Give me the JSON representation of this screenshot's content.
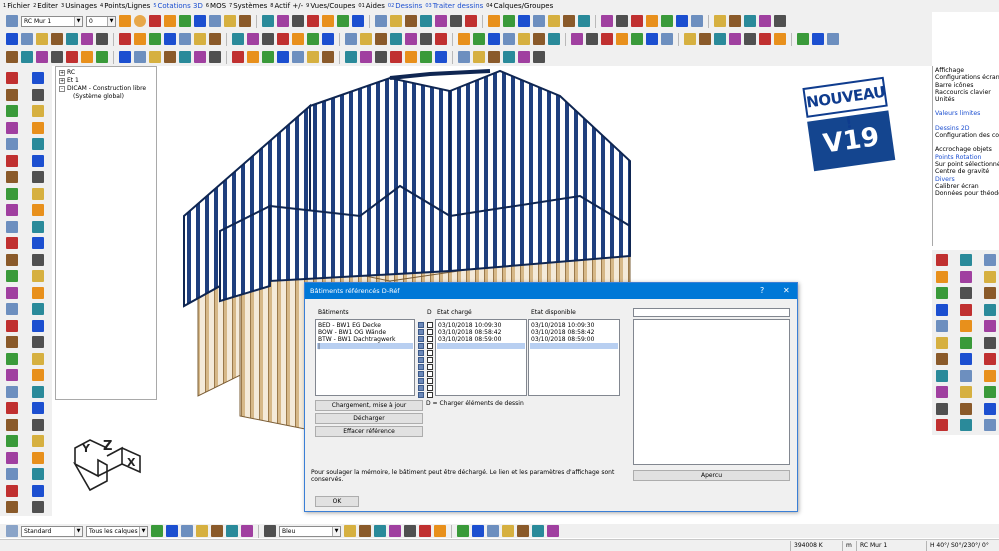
{
  "menu": [
    {
      "num": "1",
      "label": "Fichier"
    },
    {
      "num": "2",
      "label": "Editer"
    },
    {
      "num": "3",
      "label": "Usinages"
    },
    {
      "num": "4",
      "label": "Points/Lignes"
    },
    {
      "num": "5",
      "label": "Cotations 3D",
      "accent": true
    },
    {
      "num": "6",
      "label": "MOS"
    },
    {
      "num": "7",
      "label": "Systèmes"
    },
    {
      "num": "8",
      "label": "Actif +/-"
    },
    {
      "num": "9",
      "label": "Vues/Coupes"
    },
    {
      "num": "01",
      "label": "Aides"
    },
    {
      "num": "02",
      "label": "Dessins",
      "accent": true
    },
    {
      "num": "03",
      "label": "Traiter dessins",
      "accent": true
    },
    {
      "num": "04",
      "label": "Calques/Groupes"
    }
  ],
  "toolbar": {
    "layer_combo": "RC Mur 1",
    "number_combo": "0"
  },
  "tree": [
    {
      "text": "RC",
      "expander": "+",
      "level": 0
    },
    {
      "text": "Et 1",
      "expander": "+",
      "level": 0
    },
    {
      "text": "DICAM - Construction libre",
      "expander": "-",
      "level": 0
    },
    {
      "text": "(Système global)",
      "expander": "",
      "level": 1
    }
  ],
  "axes": {
    "x": "X",
    "y": "Y",
    "z": "Z"
  },
  "right_panel": [
    {
      "text": "Affichage"
    },
    {
      "text": "Configurations écran"
    },
    {
      "text": "Barre icônes"
    },
    {
      "text": "Raccourcis clavier"
    },
    {
      "text": "Unités"
    },
    {
      "text": "",
      "gap": true
    },
    {
      "text": "Valeurs limites",
      "accent": true
    },
    {
      "text": "",
      "gap": true
    },
    {
      "text": "Dessins 2D",
      "accent": true
    },
    {
      "text": "Configuration des co"
    },
    {
      "text": "",
      "gap": true
    },
    {
      "text": "Accrochage objets"
    },
    {
      "text": "Points Rotation",
      "accent": true
    },
    {
      "text": "Sur point sélectionné"
    },
    {
      "text": "Centre de gravité"
    },
    {
      "text": "Divers",
      "accent": true
    },
    {
      "text": "Calibrer écran"
    },
    {
      "text": "Données pour théodo"
    }
  ],
  "badge": {
    "line1": "NOUVEAU !",
    "line2": "V19"
  },
  "dialog": {
    "title": "Bâtiments référencés D-Réf",
    "help": "?",
    "close": "✕",
    "col_buildings": "Bâtiments",
    "col_d": "D",
    "col_loaded": "Etat chargé",
    "col_available": "Etat disponible",
    "rows": [
      {
        "name": "BED - BW1 EG Decke",
        "loaded": "03/10/2018   10:09:30",
        "available": "03/10/2018   10:09:30"
      },
      {
        "name": "BOW - BW1 OG Wände",
        "loaded": "03/10/2018   08:58:42",
        "available": "03/10/2018   08:58:42"
      },
      {
        "name": "BTW - BW1 Dachtragwerk",
        "loaded": "03/10/2018   08:59:00",
        "available": "03/10/2018   08:59:00"
      },
      {
        "name": "|",
        "loaded": "",
        "available": ""
      }
    ],
    "btn_load": "Chargement, mise à jour",
    "btn_unload": "Décharger",
    "btn_clear": "Effacer référence",
    "legend": "D = Charger éléments de dessin",
    "memo": "Pour soulager la mémoire, le bâtiment peut être déchargé. Le lien et les paramètres d'affichage sont conservés.",
    "btn_preview": "Apercu",
    "btn_ok": "OK"
  },
  "bottom_bar": {
    "style_combo": "Standard",
    "layers_combo": "Tous les calques",
    "color_combo": "Bleu"
  },
  "status": {
    "coord": "394008 K",
    "unit": "m",
    "layer": "RC Mur 1",
    "view": "H 40°/ S0°/230°/ 0°"
  }
}
